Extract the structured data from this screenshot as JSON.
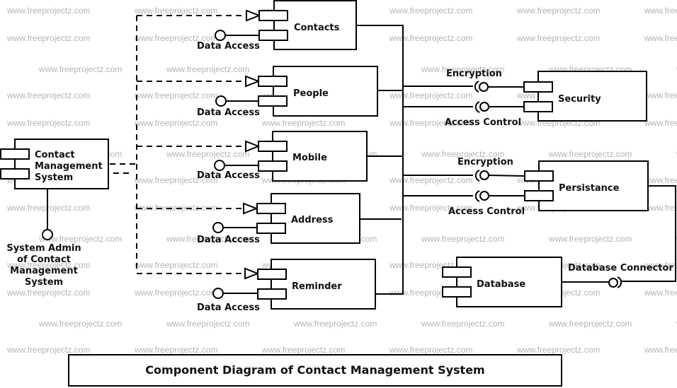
{
  "watermark": "www.freeprojectz.com",
  "title": "Component Diagram of Contact Management System",
  "main_component": {
    "name_lines": [
      "Contact",
      "Management",
      "System"
    ],
    "interface_lines": [
      "System Admin",
      "of Contact",
      "Management",
      "System"
    ]
  },
  "components": [
    {
      "name": "Contacts",
      "interface": "Data Access"
    },
    {
      "name": "People",
      "interface": "Data Access"
    },
    {
      "name": "Mobile",
      "interface": "Data Access"
    },
    {
      "name": "Address",
      "interface": "Data Access"
    },
    {
      "name": "Reminder",
      "interface": "Data Access"
    }
  ],
  "services": [
    {
      "name": "Security",
      "interfaces": [
        "Encryption",
        "Access Control"
      ]
    },
    {
      "name": "Persistance",
      "interfaces": [
        "Encryption",
        "Access Control"
      ]
    }
  ],
  "database": {
    "name": "Database",
    "interface": "Database Connector"
  }
}
